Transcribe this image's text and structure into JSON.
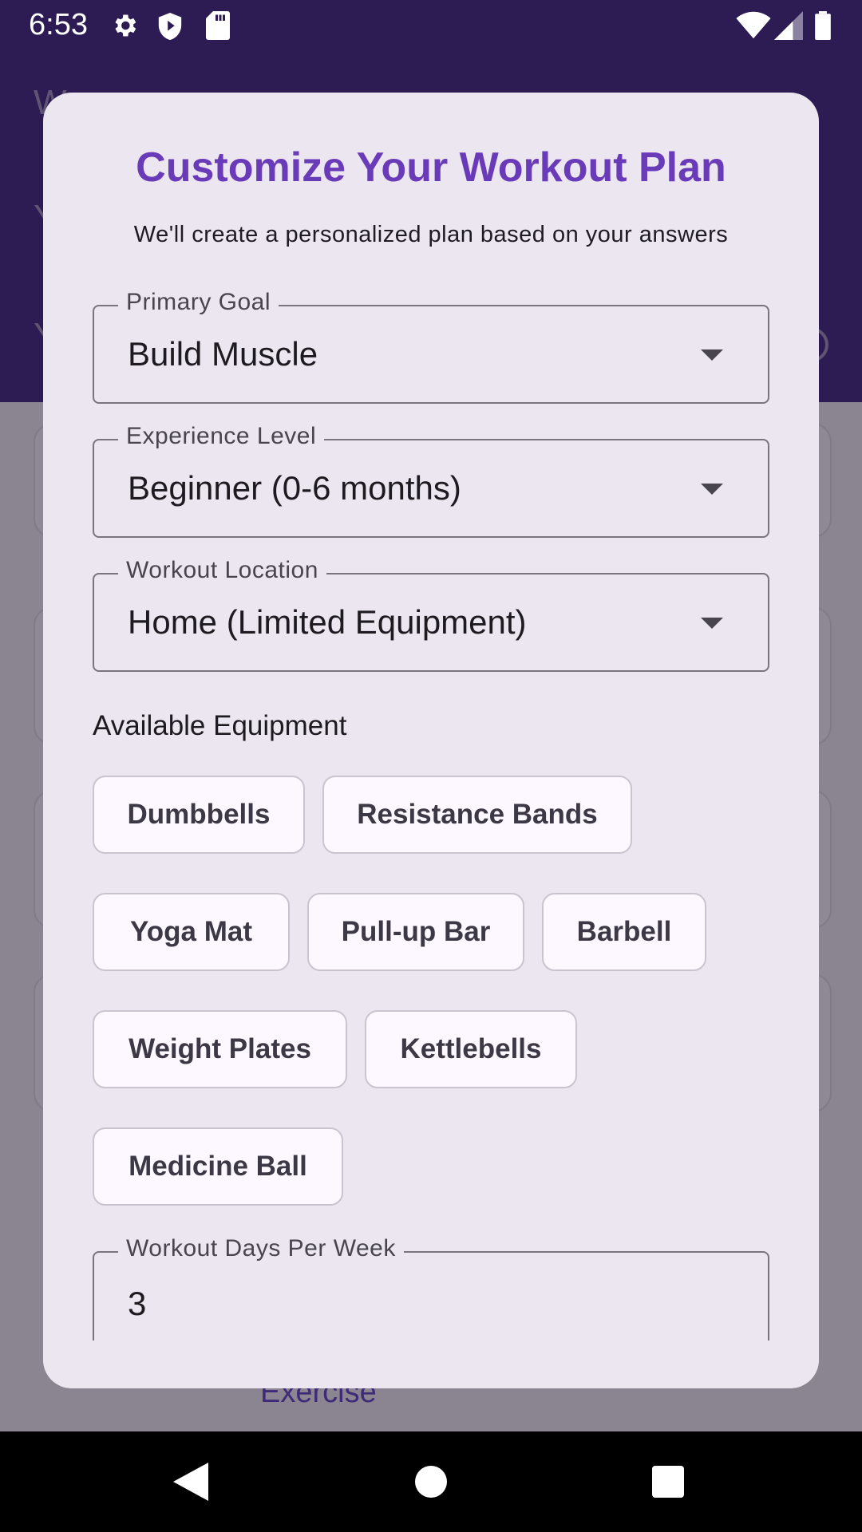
{
  "status_bar": {
    "time": "6:53",
    "icons": [
      "gear-icon",
      "shield-icon",
      "sd-card-icon",
      "wifi-icon",
      "signal-icon",
      "battery-icon"
    ]
  },
  "background": {
    "exercise_label": "Exercise"
  },
  "dialog": {
    "title": "Customize Your Workout Plan",
    "subtitle": "We'll create a personalized plan based on your answers",
    "primary_goal": {
      "label": "Primary Goal",
      "value": "Build Muscle"
    },
    "experience_level": {
      "label": "Experience Level",
      "value": "Beginner (0-6 months)"
    },
    "workout_location": {
      "label": "Workout Location",
      "value": "Home (Limited Equipment)"
    },
    "equipment_title": "Available Equipment",
    "equipment": [
      "Dumbbells",
      "Resistance Bands",
      "Yoga Mat",
      "Pull-up Bar",
      "Barbell",
      "Weight Plates",
      "Kettlebells",
      "Medicine Ball"
    ],
    "workout_days": {
      "label": "Workout Days Per Week",
      "value": "3"
    }
  },
  "colors": {
    "accent": "#6a3bb8",
    "header": "#2d1b54",
    "dialog_bg": "#ece6f0",
    "outline": "#79747e"
  }
}
